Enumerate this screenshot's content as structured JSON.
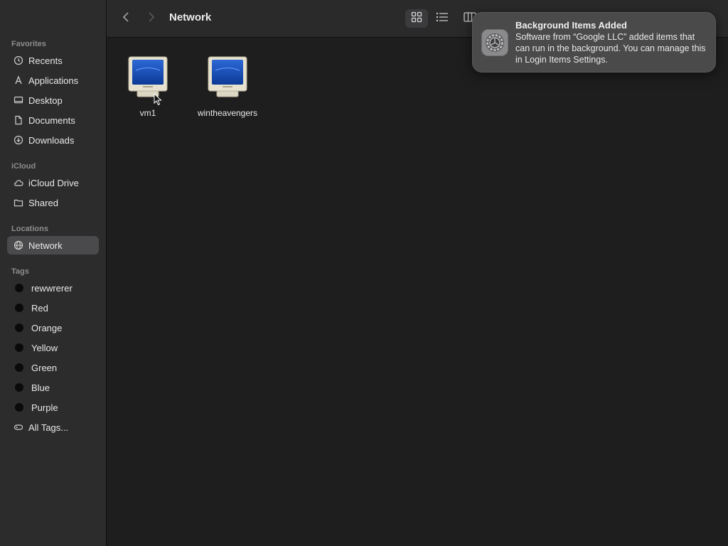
{
  "toolbar": {
    "title": "Network",
    "back_icon": "chevron-left-icon",
    "forward_icon": "chevron-right-icon"
  },
  "sidebar": {
    "favorites_label": "Favorites",
    "favorites": [
      {
        "label": "Recents",
        "icon": "clock-icon"
      },
      {
        "label": "Applications",
        "icon": "applications-icon"
      },
      {
        "label": "Desktop",
        "icon": "desktop-icon"
      },
      {
        "label": "Documents",
        "icon": "document-icon"
      },
      {
        "label": "Downloads",
        "icon": "download-icon"
      }
    ],
    "icloud_label": "iCloud",
    "icloud": [
      {
        "label": "iCloud Drive",
        "icon": "cloud-icon"
      },
      {
        "label": "Shared",
        "icon": "shared-folder-icon"
      }
    ],
    "locations_label": "Locations",
    "locations": [
      {
        "label": "Network",
        "icon": "globe-icon",
        "selected": true
      }
    ],
    "tags_label": "Tags",
    "tags": [
      {
        "label": "rewwrerer"
      },
      {
        "label": "Red"
      },
      {
        "label": "Orange"
      },
      {
        "label": "Yellow"
      },
      {
        "label": "Green"
      },
      {
        "label": "Blue"
      },
      {
        "label": "Purple"
      }
    ],
    "all_tags": "All Tags..."
  },
  "content": {
    "items": [
      {
        "label": "vm1",
        "icon": "computer-icon"
      },
      {
        "label": "wintheavengers",
        "icon": "computer-icon"
      }
    ]
  },
  "notification": {
    "title": "Background Items Added",
    "body": "Software from “Google LLC” added items that can run in the background. You can manage this in Login Items Settings.",
    "icon": "settings-gear-icon"
  },
  "colors": {
    "sidebar_bg": "#2c2c2d",
    "content_bg": "#1e1e1e",
    "selection": "#4a4a4c",
    "notification_bg": "#4a4a4b"
  }
}
